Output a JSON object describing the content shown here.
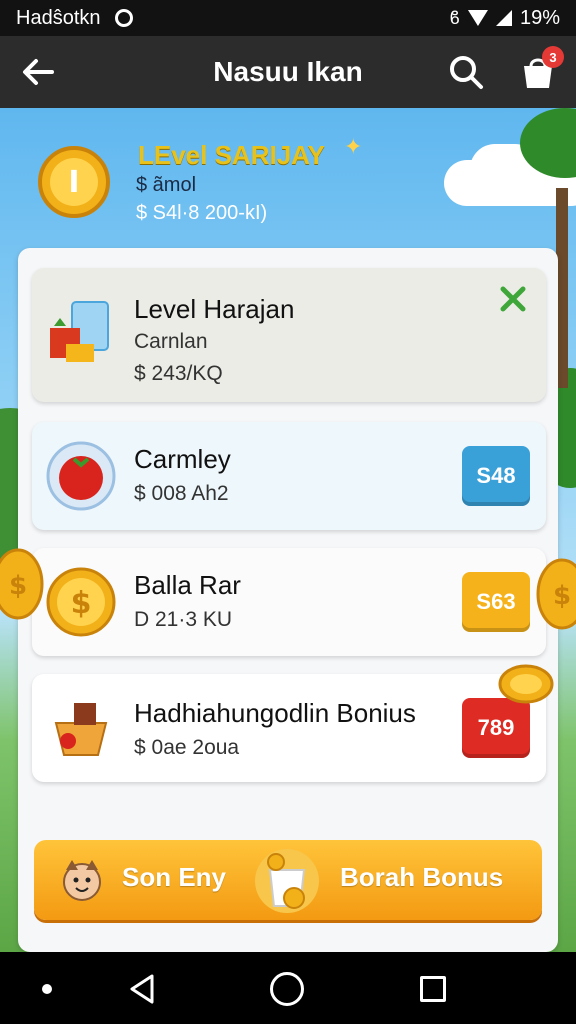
{
  "status_bar": {
    "carrier": "Hadŝotkn",
    "battery": "19%"
  },
  "app_bar": {
    "title": "Nasuu Ikan",
    "badge_count": "3"
  },
  "header": {
    "title": "LEvel SARIJAY",
    "line1": "$ ãmol",
    "line2": "$ S4l·8 200-kI)"
  },
  "items": [
    {
      "name": "Level Harajan",
      "sub1": "Carnlan",
      "sub2": "$ 243/KQ",
      "price": ""
    },
    {
      "name": "Carmley",
      "sub1": "$ 008 Ah2",
      "price": "S48"
    },
    {
      "name": "Balla Rar",
      "sub1": "D 21·3 KU",
      "price": "S63"
    },
    {
      "name": "Hadhiahungodlin Bonius",
      "sub1": "$ 0ae 2oua",
      "price": "789"
    }
  ],
  "banner": {
    "left_label": "Son Eny",
    "right_label": "Borah Bonus"
  },
  "colors": {
    "blue_btn": "#3aa0d8",
    "yellow_btn": "#f5b21b",
    "red_btn": "#de2b24",
    "banner_top": "#ffc43a",
    "banner_bottom": "#f39a12"
  }
}
